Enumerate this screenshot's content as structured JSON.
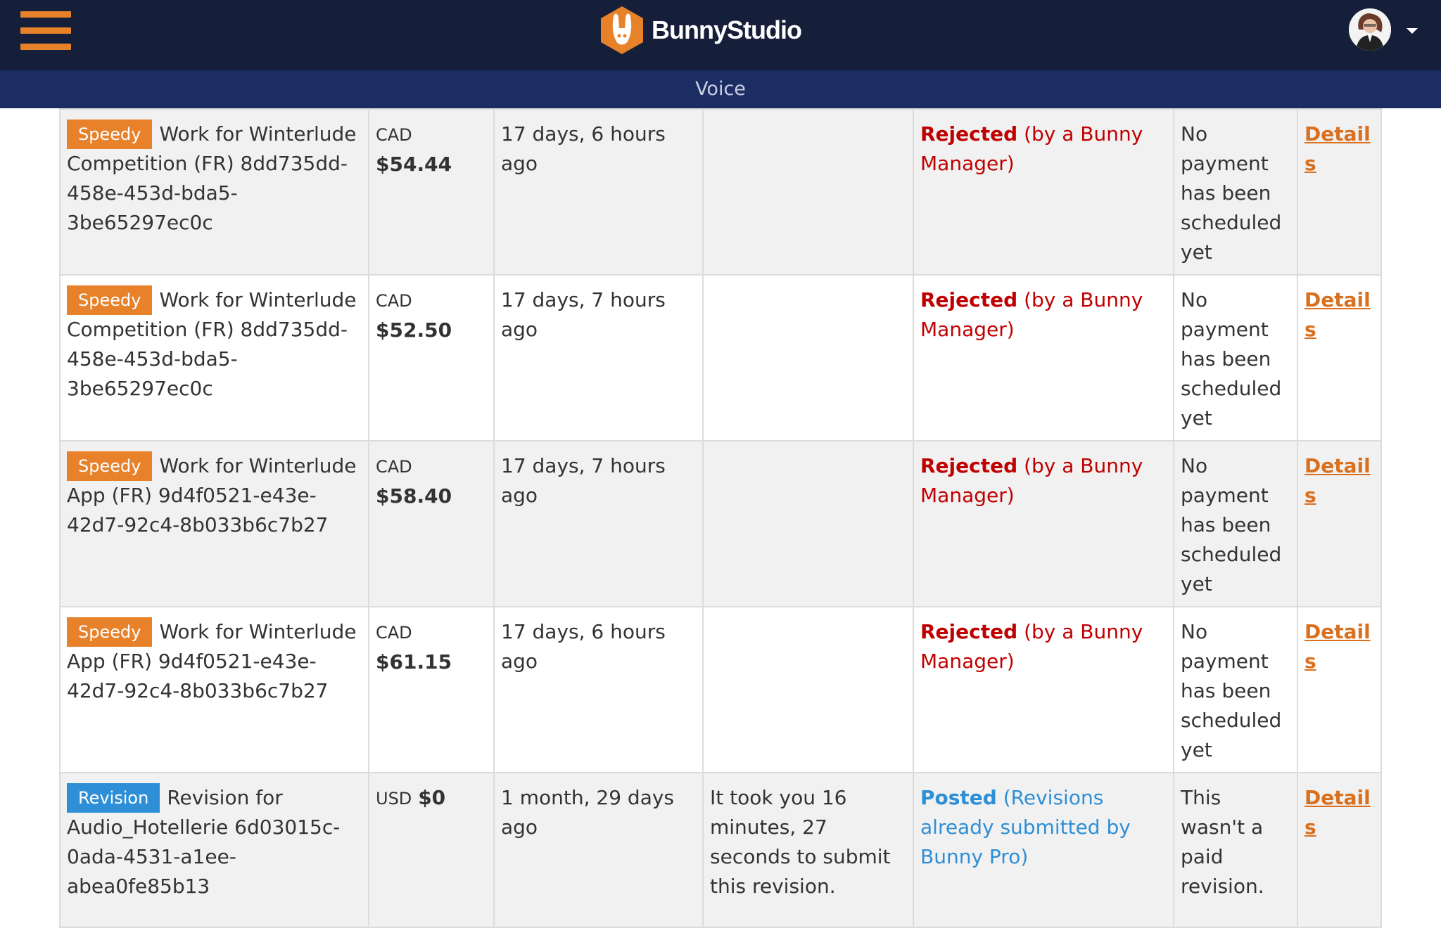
{
  "header": {
    "brand": "BunnyStudio",
    "menu_icon": "hamburger-menu-icon",
    "avatar_icon": "user-avatar",
    "dropdown_icon": "caret-down-icon",
    "colors": {
      "topbar": "#161f3a",
      "subnav": "#1c2d63",
      "accent": "#e8822a",
      "revision": "#2e8fd6",
      "rejected": "#c00000"
    }
  },
  "subnav": {
    "title": "Voice"
  },
  "rows": [
    {
      "badge": "Speedy",
      "title": "Work for Winterlude Competition (FR) 8dd735dd-458e-453d-bda5-3be65297ec0c",
      "currency": "CAD",
      "amount": "$54.44",
      "time": "17 days, 6 hours ago",
      "note": "",
      "status": "Rejected",
      "status_detail": "(by a Bunny Manager)",
      "payment": "No payment has been scheduled yet",
      "link": "Details"
    },
    {
      "badge": "Speedy",
      "title": "Work for Winterlude Competition (FR) 8dd735dd-458e-453d-bda5-3be65297ec0c",
      "currency": "CAD",
      "amount": "$52.50",
      "time": "17 days, 7 hours ago",
      "note": "",
      "status": "Rejected",
      "status_detail": "(by a Bunny Manager)",
      "payment": "No payment has been scheduled yet",
      "link": "Details"
    },
    {
      "badge": "Speedy",
      "title": "Work for Winterlude App (FR) 9d4f0521-e43e-42d7-92c4-8b033b6c7b27",
      "currency": "CAD",
      "amount": "$58.40",
      "time": "17 days, 7 hours ago",
      "note": "",
      "status": "Rejected",
      "status_detail": "(by a Bunny Manager)",
      "payment": "No payment has been scheduled yet",
      "link": "Details"
    },
    {
      "badge": "Speedy",
      "title": "Work for Winterlude App (FR) 9d4f0521-e43e-42d7-92c4-8b033b6c7b27",
      "currency": "CAD",
      "amount": "$61.15",
      "time": "17 days, 6 hours ago",
      "note": "",
      "status": "Rejected",
      "status_detail": "(by a Bunny Manager)",
      "payment": "No payment has been scheduled yet",
      "link": "Details"
    },
    {
      "badge": "Revision",
      "title": "Revision for Audio_Hotellerie 6d03015c-0ada-4531-a1ee-abea0fe85b13",
      "currency": "USD",
      "amount": "$0",
      "time": "1 month, 29 days ago",
      "note": "It took you 16 minutes, 27 seconds to submit this revision.",
      "status": "Posted",
      "status_detail": "(Revisions already submitted by Bunny Pro)",
      "payment": "This wasn't a paid revision.",
      "link": "Details"
    }
  ]
}
